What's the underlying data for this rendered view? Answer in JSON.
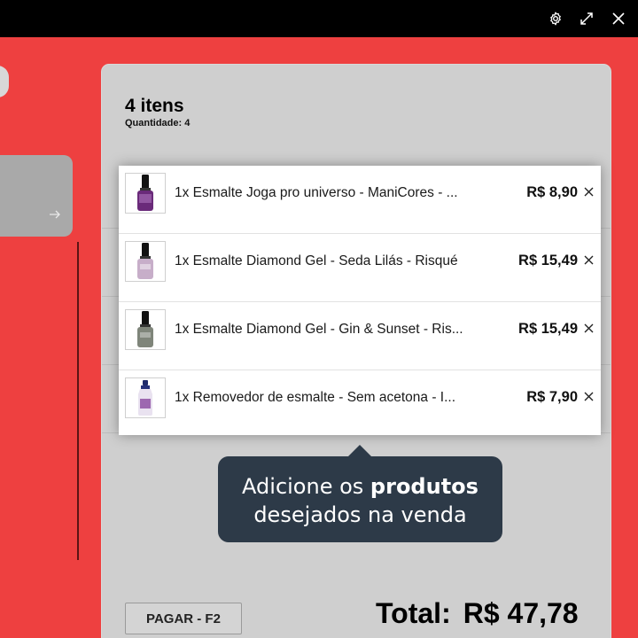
{
  "window": {
    "controls": [
      {
        "name": "settings",
        "icon": "gear-icon"
      },
      {
        "name": "maximize",
        "icon": "expand-icon"
      },
      {
        "name": "close",
        "icon": "close-icon"
      }
    ]
  },
  "cart": {
    "title": "4 itens",
    "quantity_label": "Quantidade:",
    "quantity_value": "4",
    "items": [
      {
        "name": "1x Esmalte Joga pro universo - ManiCores - ...",
        "price": "R$ 8,90",
        "polish_color": "#6a2a7a",
        "icon": "nail-polish-icon"
      },
      {
        "name": "1x Esmalte Diamond Gel - Seda Lilás - Risqué",
        "price": "R$ 15,49",
        "polish_color": "#c7aec9",
        "icon": "nail-polish-icon"
      },
      {
        "name": "1x Esmalte Diamond Gel - Gin & Sunset - Ris...",
        "price": "R$ 15,49",
        "polish_color": "#7f857a",
        "icon": "nail-polish-icon"
      },
      {
        "name": "1x Removedor de esmalte - Sem acetona - I...",
        "price": "R$ 7,90",
        "polish_color": "#8a4aa0",
        "icon": "remover-bottle-icon"
      }
    ],
    "remove_icon": "close-icon",
    "pay_button": "PAGAR - F2",
    "total_label": "Total:",
    "total_value": "R$ 47,78"
  },
  "tooltip": {
    "line1_prefix": "Adicione os ",
    "line1_bold": "produtos",
    "line2": "desejados na venda"
  },
  "colors": {
    "background": "#ee4040",
    "panel": "#cfcfcf",
    "tooltip": "#2d3a48"
  }
}
